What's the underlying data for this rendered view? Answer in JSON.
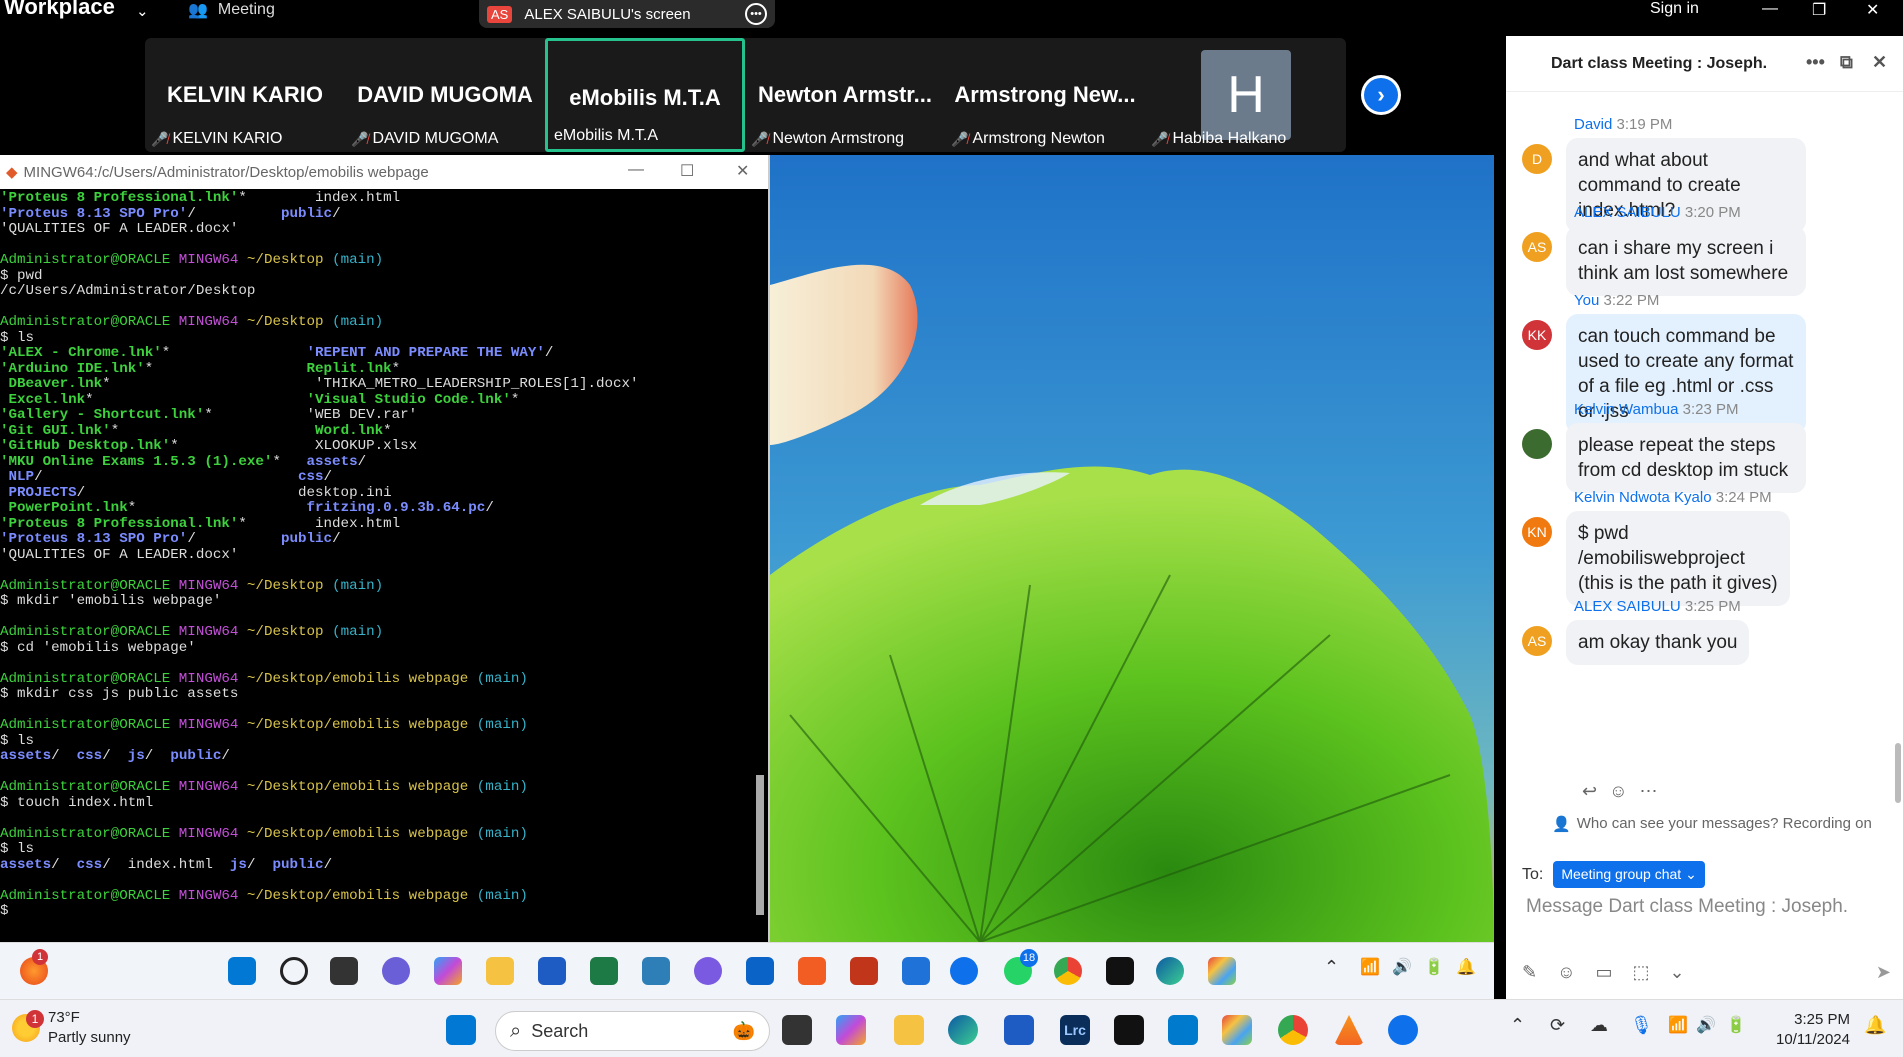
{
  "zoom": {
    "brand": "Workplace",
    "meeting_label": "Meeting",
    "share_badge": "AS",
    "share_label": "ALEX SAIBULU's screen",
    "sign_in": "Sign in"
  },
  "gallery": [
    {
      "big": "KELVIN KARIO",
      "small": "KELVIN KARIO",
      "muted": true
    },
    {
      "big": "DAVID MUGOMA",
      "small": "DAVID MUGOMA",
      "muted": true
    },
    {
      "big": "eMobilis M.T.A",
      "small": "eMobilis M.T.A",
      "muted": false
    },
    {
      "big": "Newton Armstr...",
      "small": "Newton Armstrong",
      "muted": true
    },
    {
      "big": "Armstrong New...",
      "small": "Armstrong Newton",
      "muted": true
    },
    {
      "big": "H",
      "small": "Habiba Halkano",
      "muted": true
    }
  ],
  "terminal": {
    "title": "MINGW64:/c/Users/Administrator/Desktop/emobilis webpage",
    "lines": [
      [
        [
          "'Proteus 8 Professional.lnk'",
          "c-gb"
        ],
        [
          "*        index.html",
          "c-w"
        ]
      ],
      [
        [
          "'Proteus 8.13 SPO Pro'",
          "c-b"
        ],
        [
          "/          ",
          "c-w"
        ],
        [
          "public",
          "c-b"
        ],
        [
          "/",
          "c-w"
        ]
      ],
      [
        [
          "'QUALITIES OF A LEADER.docx'",
          "c-w"
        ]
      ],
      [
        [
          "",
          "c-w"
        ]
      ],
      [
        [
          "Administrator@ORACLE ",
          "c-g"
        ],
        [
          "MINGW64 ",
          "c-m"
        ],
        [
          "~/Desktop ",
          "c-y"
        ],
        [
          "(main)",
          "c-c"
        ]
      ],
      [
        [
          "$ pwd",
          "c-w"
        ]
      ],
      [
        [
          "/c/Users/Administrator/Desktop",
          "c-w"
        ]
      ],
      [
        [
          "",
          "c-w"
        ]
      ],
      [
        [
          "Administrator@ORACLE ",
          "c-g"
        ],
        [
          "MINGW64 ",
          "c-m"
        ],
        [
          "~/Desktop ",
          "c-y"
        ],
        [
          "(main)",
          "c-c"
        ]
      ],
      [
        [
          "$ ls",
          "c-w"
        ]
      ],
      [
        [
          "'ALEX - Chrome.lnk'",
          "c-gb"
        ],
        [
          "*                ",
          "c-w"
        ],
        [
          "'REPENT AND PREPARE THE WAY'",
          "c-b"
        ],
        [
          "/",
          "c-w"
        ]
      ],
      [
        [
          "'Arduino IDE.lnk'",
          "c-gb"
        ],
        [
          "*                  ",
          "c-w"
        ],
        [
          "Replit.lnk",
          "c-gb"
        ],
        [
          "*",
          "c-w"
        ]
      ],
      [
        [
          " DBeaver.lnk",
          "c-gb"
        ],
        [
          "*                        'THIKA_METRO_LEADERSHIP_ROLES[1].docx'",
          "c-w"
        ]
      ],
      [
        [
          " Excel.lnk",
          "c-gb"
        ],
        [
          "*                         ",
          "c-w"
        ],
        [
          "'Visual Studio Code.lnk'",
          "c-gb"
        ],
        [
          "*",
          "c-w"
        ]
      ],
      [
        [
          "'Gallery - Shortcut.lnk'",
          "c-gb"
        ],
        [
          "*           'WEB DEV.rar'",
          "c-w"
        ]
      ],
      [
        [
          "'Git GUI.lnk'",
          "c-gb"
        ],
        [
          "*                       ",
          "c-w"
        ],
        [
          "Word.lnk",
          "c-gb"
        ],
        [
          "*",
          "c-w"
        ]
      ],
      [
        [
          "'GitHub Desktop.lnk'",
          "c-gb"
        ],
        [
          "*                XLOOKUP.xlsx",
          "c-w"
        ]
      ],
      [
        [
          "'MKU Online Exams 1.5.3 (1).exe'",
          "c-gb"
        ],
        [
          "*   ",
          "c-w"
        ],
        [
          "assets",
          "c-b"
        ],
        [
          "/",
          "c-w"
        ]
      ],
      [
        [
          " NLP",
          "c-b"
        ],
        [
          "/                              ",
          "c-w"
        ],
        [
          "css",
          "c-b"
        ],
        [
          "/",
          "c-w"
        ]
      ],
      [
        [
          " PROJECTS",
          "c-b"
        ],
        [
          "/                         desktop.ini",
          "c-w"
        ]
      ],
      [
        [
          " PowerPoint.lnk",
          "c-gb"
        ],
        [
          "*                    ",
          "c-w"
        ],
        [
          "fritzing.0.9.3b.64.pc",
          "c-b"
        ],
        [
          "/",
          "c-w"
        ]
      ],
      [
        [
          "'Proteus 8 Professional.lnk'",
          "c-gb"
        ],
        [
          "*        index.html",
          "c-w"
        ]
      ],
      [
        [
          "'Proteus 8.13 SPO Pro'",
          "c-b"
        ],
        [
          "/          ",
          "c-w"
        ],
        [
          "public",
          "c-b"
        ],
        [
          "/",
          "c-w"
        ]
      ],
      [
        [
          "'QUALITIES OF A LEADER.docx'",
          "c-w"
        ]
      ],
      [
        [
          "",
          "c-w"
        ]
      ],
      [
        [
          "Administrator@ORACLE ",
          "c-g"
        ],
        [
          "MINGW64 ",
          "c-m"
        ],
        [
          "~/Desktop ",
          "c-y"
        ],
        [
          "(main)",
          "c-c"
        ]
      ],
      [
        [
          "$ mkdir 'emobilis webpage'",
          "c-w"
        ]
      ],
      [
        [
          "",
          "c-w"
        ]
      ],
      [
        [
          "Administrator@ORACLE ",
          "c-g"
        ],
        [
          "MINGW64 ",
          "c-m"
        ],
        [
          "~/Desktop ",
          "c-y"
        ],
        [
          "(main)",
          "c-c"
        ]
      ],
      [
        [
          "$ cd 'emobilis webpage'",
          "c-w"
        ]
      ],
      [
        [
          "",
          "c-w"
        ]
      ],
      [
        [
          "Administrator@ORACLE ",
          "c-g"
        ],
        [
          "MINGW64 ",
          "c-m"
        ],
        [
          "~/Desktop/emobilis webpage ",
          "c-y"
        ],
        [
          "(main)",
          "c-c"
        ]
      ],
      [
        [
          "$ mkdir css js public assets",
          "c-w"
        ]
      ],
      [
        [
          "",
          "c-w"
        ]
      ],
      [
        [
          "Administrator@ORACLE ",
          "c-g"
        ],
        [
          "MINGW64 ",
          "c-m"
        ],
        [
          "~/Desktop/emobilis webpage ",
          "c-y"
        ],
        [
          "(main)",
          "c-c"
        ]
      ],
      [
        [
          "$ ls",
          "c-w"
        ]
      ],
      [
        [
          "assets",
          "c-b"
        ],
        [
          "/  ",
          "c-w"
        ],
        [
          "css",
          "c-b"
        ],
        [
          "/  ",
          "c-w"
        ],
        [
          "js",
          "c-b"
        ],
        [
          "/  ",
          "c-w"
        ],
        [
          "public",
          "c-b"
        ],
        [
          "/",
          "c-w"
        ]
      ],
      [
        [
          "",
          "c-w"
        ]
      ],
      [
        [
          "Administrator@ORACLE ",
          "c-g"
        ],
        [
          "MINGW64 ",
          "c-m"
        ],
        [
          "~/Desktop/emobilis webpage ",
          "c-y"
        ],
        [
          "(main)",
          "c-c"
        ]
      ],
      [
        [
          "$ touch index.html",
          "c-w"
        ]
      ],
      [
        [
          "",
          "c-w"
        ]
      ],
      [
        [
          "Administrator@ORACLE ",
          "c-g"
        ],
        [
          "MINGW64 ",
          "c-m"
        ],
        [
          "~/Desktop/emobilis webpage ",
          "c-y"
        ],
        [
          "(main)",
          "c-c"
        ]
      ],
      [
        [
          "$ ls",
          "c-w"
        ]
      ],
      [
        [
          "assets",
          "c-b"
        ],
        [
          "/  ",
          "c-w"
        ],
        [
          "css",
          "c-b"
        ],
        [
          "/  index.html  ",
          "c-w"
        ],
        [
          "js",
          "c-b"
        ],
        [
          "/  ",
          "c-w"
        ],
        [
          "public",
          "c-b"
        ],
        [
          "/",
          "c-w"
        ]
      ],
      [
        [
          "",
          "c-w"
        ]
      ],
      [
        [
          "Administrator@ORACLE ",
          "c-g"
        ],
        [
          "MINGW64 ",
          "c-m"
        ],
        [
          "~/Desktop/emobilis webpage ",
          "c-y"
        ],
        [
          "(main)",
          "c-c"
        ]
      ],
      [
        [
          "$ ",
          "c-w"
        ]
      ]
    ]
  },
  "inner_taskbar": {
    "notif_count": "1",
    "whatsapp_badge": "18"
  },
  "outer_taskbar": {
    "weather_badge": "1",
    "temp": "73°F",
    "condition": "Partly sunny",
    "search_label": "Search",
    "time": "3:25 PM",
    "date": "10/11/2024"
  },
  "chat": {
    "title": "Dart class Meeting : Joseph.",
    "messages": [
      {
        "name": "David",
        "time": "3:19 PM",
        "initials": "D",
        "color": "#f0a020",
        "text": "and what about command to create index.html?",
        "mine": false
      },
      {
        "name": "ALEX SAIBULU",
        "time": "3:20 PM",
        "initials": "AS",
        "color": "#f0a020",
        "text": "can i share my screen i think am lost somewhere",
        "mine": false
      },
      {
        "name": "You",
        "time": "3:22 PM",
        "initials": "KK",
        "color": "#d13438",
        "text": "can touch command be used to create any format of a file eg .html or .css or .jss",
        "mine": true
      },
      {
        "name": "Kelvin Wambua",
        "time": "3:23 PM",
        "initials": "",
        "color": "#3b6b2f",
        "text": "please repeat the steps from cd desktop im stuck",
        "mine": false
      },
      {
        "name": "Kelvin Ndwota Kyalo",
        "time": "3:24 PM",
        "initials": "KN",
        "color": "#f07a10",
        "text": "$ pwd\n/emobiliswebproject\n(this is the path it gives)",
        "mine": false
      },
      {
        "name": "ALEX SAIBULU",
        "time": "3:25 PM",
        "initials": "AS",
        "color": "#f0a020",
        "text": "am okay thank you",
        "mine": false
      }
    ],
    "privacy": "Who can see your messages? Recording on",
    "to_label": "To:",
    "to_target": "Meeting group chat",
    "compose_placeholder": "Message Dart class Meeting : Joseph."
  }
}
